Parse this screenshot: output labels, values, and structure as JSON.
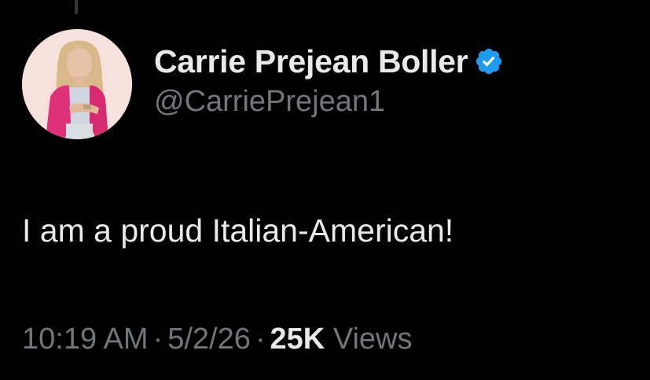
{
  "author": {
    "display_name": "Carrie Prejean Boller",
    "handle": "@CarriePrejean1",
    "verified": true,
    "verified_icon": "verified-badge-icon",
    "badge_color": "#1d9bf0"
  },
  "tweet": {
    "text": "I am a proud Italian-American!",
    "time": "10:19 AM",
    "date": "5/2/26",
    "views_count": "25K",
    "views_label": "Views",
    "separator": "·"
  },
  "theme": {
    "background": "#000000",
    "text_primary": "#e7e9ea",
    "text_secondary": "#71767b"
  }
}
